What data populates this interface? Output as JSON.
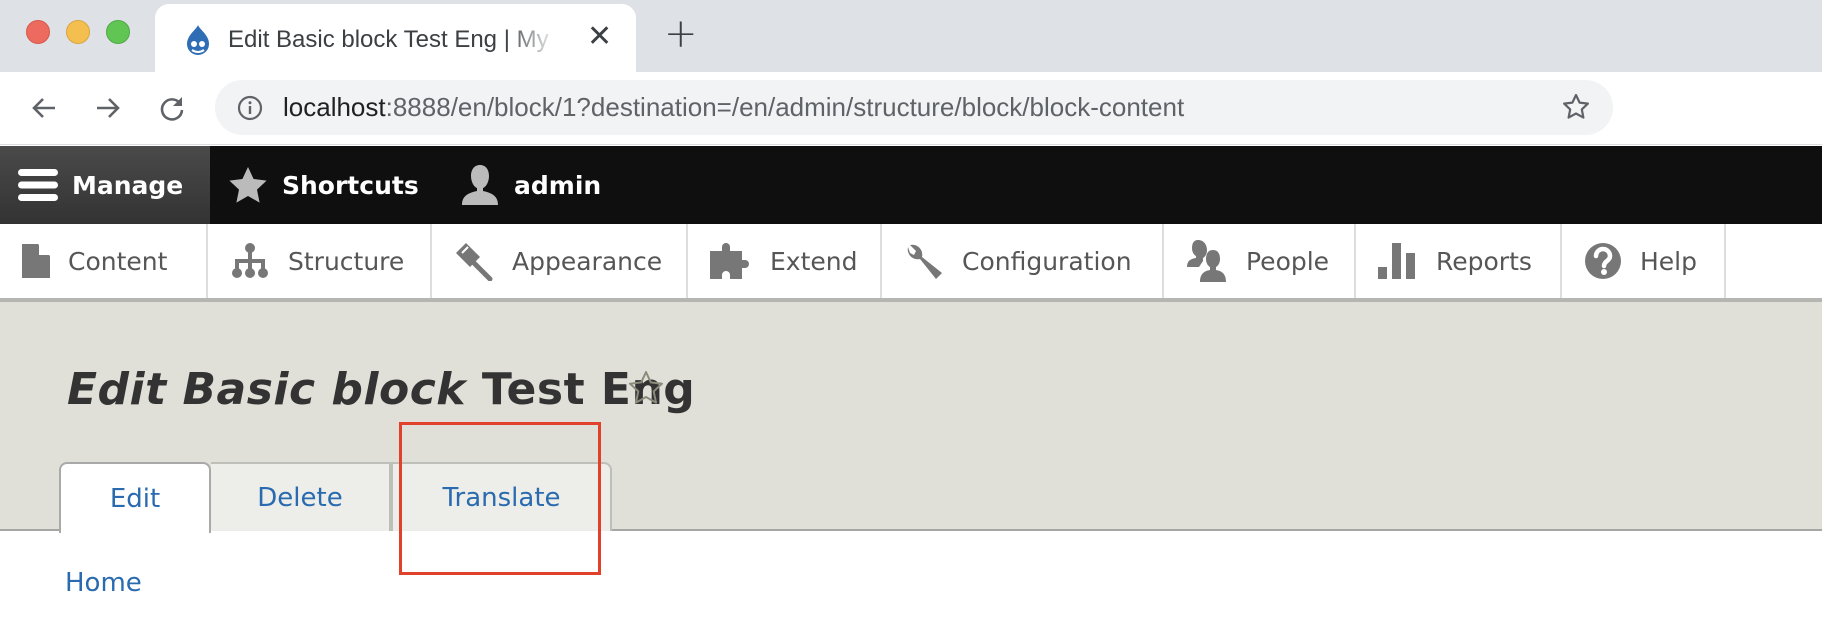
{
  "browser": {
    "tab": {
      "title": "Edit Basic block Test Eng | My Site",
      "favicon": "drupal-drop-icon",
      "close_icon": "close-icon"
    },
    "new_tab_icon": "plus-icon",
    "nav": {
      "back_icon": "arrow-left-icon",
      "forward_icon": "arrow-right-icon",
      "reload_icon": "reload-icon"
    },
    "address": {
      "host": "localhost",
      "rest": ":8888/en/block/1?destination=/en/admin/structure/block/block-content",
      "info_icon": "info-icon",
      "bookmark_icon": "star-outline-icon"
    },
    "window_controls": {
      "close_color": "#ed6a5e",
      "minimize_color": "#f5bf4f",
      "maximize_color": "#61c554"
    }
  },
  "toolbar": {
    "manage": "Manage",
    "shortcuts": "Shortcuts",
    "user": "admin"
  },
  "tray": {
    "items": [
      {
        "label": "Content",
        "icon": "file-icon"
      },
      {
        "label": "Structure",
        "icon": "hierarchy-icon"
      },
      {
        "label": "Appearance",
        "icon": "paintbrush-icon"
      },
      {
        "label": "Extend",
        "icon": "puzzle-icon"
      },
      {
        "label": "Configuration",
        "icon": "wrench-icon"
      },
      {
        "label": "People",
        "icon": "people-icon"
      },
      {
        "label": "Reports",
        "icon": "bar-chart-icon"
      },
      {
        "label": "Help",
        "icon": "question-icon"
      }
    ]
  },
  "page": {
    "title_italic": "Edit Basic block",
    "title_rest": "Test Eng",
    "tabs": [
      {
        "label": "Edit",
        "active": true
      },
      {
        "label": "Delete",
        "active": false
      },
      {
        "label": "Translate",
        "active": false
      }
    ],
    "breadcrumb": [
      "Home"
    ]
  },
  "colors": {
    "link": "#2a6bb0",
    "highlight": "#e1402a",
    "header_bg": "#e0e0d8",
    "toolbar_bg": "#0f0f0f"
  }
}
